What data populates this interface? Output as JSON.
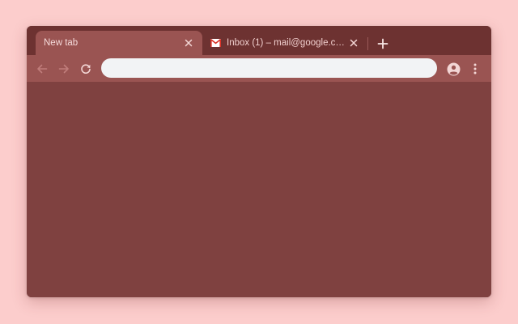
{
  "tabs": [
    {
      "title": "New tab",
      "active": true,
      "favicon": "none"
    },
    {
      "title": "Inbox (1) – mail@google.com",
      "active": false,
      "favicon": "gmail-icon"
    }
  ],
  "tab_close_icon": "close-icon",
  "new_tab_icon": "plus-icon",
  "toolbar": {
    "back_icon": "arrow-left-icon",
    "forward_icon": "arrow-right-icon",
    "reload_icon": "reload-icon",
    "profile_icon": "account-circle-icon",
    "menu_icon": "kebab-menu-icon"
  },
  "omnibox": {
    "value": "",
    "placeholder": ""
  },
  "colors": {
    "page_background": "#fccdcc",
    "tabstrip": "#6d3231",
    "active_tab": "#9a5452",
    "toolbar": "#9a5452",
    "content": "#7f4140",
    "omnibox": "#f2f3f5",
    "icon_muted": "#c07d7b",
    "icon_light": "#f3d6d5"
  }
}
